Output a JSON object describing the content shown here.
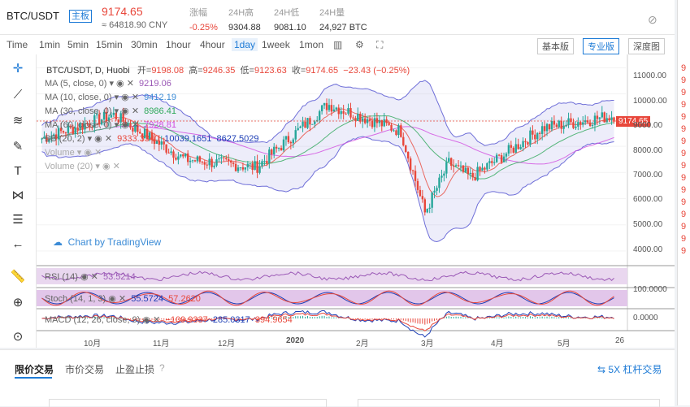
{
  "header": {
    "pair": "BTC/USDT",
    "tag": "主板",
    "price": "9174.65",
    "cny": "≈ 64818.90 CNY",
    "stats": [
      {
        "label": "涨幅",
        "value": "-0.25%",
        "red": true
      },
      {
        "label": "24H高",
        "value": "9304.88",
        "red": false
      },
      {
        "label": "24H低",
        "value": "9081.10",
        "red": false
      },
      {
        "label": "24H量",
        "value": "24,927 BTC",
        "red": false
      }
    ]
  },
  "toolbar": {
    "timeframes": [
      "Time",
      "1min",
      "5min",
      "15min",
      "30min",
      "1hour",
      "4hour",
      "1day",
      "1week",
      "1mon"
    ],
    "active": "1day",
    "versions": [
      "基本版",
      "专业版",
      "深度图"
    ],
    "active_version": "专业版"
  },
  "legend": {
    "symbol": "BTC/USDT, D, Huobi",
    "open_label": "开=",
    "open": "9198.08",
    "high_label": "高=",
    "high": "9246.35",
    "low_label": "低=",
    "low": "9123.63",
    "close_label": "收=",
    "close": "9174.65",
    "change": "−23.43 (−0.25%)",
    "ma5_label": "MA (5, close, 0)",
    "ma5": "9219.06",
    "ma10_label": "MA (10, close, 0)",
    "ma10": "9412.19",
    "ma30_label": "MA (30, close, 0)",
    "ma30": "8986.41",
    "ma60_label": "MA (60, close, 0)",
    "ma60": "7928.81",
    "bb_label": "BB (20, 2)",
    "bb_mid": "9333.3340",
    "bb_up": "10039.1651",
    "bb_low": "8627.5029",
    "vol_label": "Volume",
    "vol20_label": "Volume (20)"
  },
  "price_tag": "9174.65",
  "yaxis": [
    "11000.00",
    "10000.00",
    "9000.00",
    "8000.00",
    "7000.00",
    "6000.00",
    "5000.00",
    "4000.00"
  ],
  "xaxis": [
    "10月",
    "11月",
    "12月",
    "2020",
    "2月",
    "3月",
    "4月",
    "5月",
    "26"
  ],
  "watermark": "Chart by TradingView",
  "rsi": {
    "label": "RSI (14)",
    "value": "53.5214",
    "axis": "100.0000"
  },
  "stoch": {
    "label": "Stoch (14, 1, 3)",
    "k": "55.5724",
    "d": "57.2620",
    "axis": "100.0000"
  },
  "macd": {
    "label": "MACD (12, 26, close, 9)",
    "hist": "−109.9337",
    "macd": "285.0317",
    "signal": "394.9654",
    "axis": "0.0000"
  },
  "bottom": {
    "tabs": [
      "限价交易",
      "市价交易",
      "止盈止损"
    ],
    "active": "限价交易",
    "leverage": "5X 杠杆交易"
  },
  "colors": {
    "up": "#26a69a",
    "down": "#e8473b",
    "accent": "#1e7bd6",
    "bb": "#6f6fd8",
    "ma5": "#9b59b6",
    "ma10": "#3b8bd6",
    "ma30": "#2ea85a",
    "ma60": "#d14be0"
  },
  "chart_data": {
    "type": "candlestick",
    "title": "BTC/USDT, D, Huobi",
    "x": [
      "10月",
      "11月",
      "12月",
      "2020",
      "2月",
      "3月",
      "4月",
      "5月"
    ],
    "close_monthly_approx": [
      8300,
      9200,
      7500,
      7200,
      9600,
      8600,
      6800,
      8700,
      9174.65
    ],
    "ylim": [
      3500,
      11200
    ],
    "last": {
      "open": 9198.08,
      "high": 9246.35,
      "low": 9123.63,
      "close": 9174.65
    }
  },
  "right_strip": [
    "9",
    "9",
    "9",
    "9",
    "9",
    "9",
    "9",
    "9",
    "9",
    "9",
    "9",
    "9",
    "9",
    "9",
    "9",
    "9"
  ]
}
